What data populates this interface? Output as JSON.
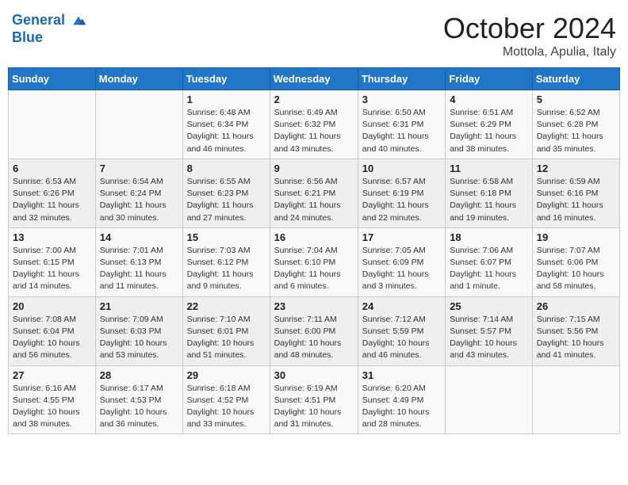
{
  "header": {
    "logo_line1": "General",
    "logo_line2": "Blue",
    "month": "October 2024",
    "location": "Mottola, Apulia, Italy"
  },
  "weekdays": [
    "Sunday",
    "Monday",
    "Tuesday",
    "Wednesday",
    "Thursday",
    "Friday",
    "Saturday"
  ],
  "weeks": [
    [
      {
        "day": "",
        "info": ""
      },
      {
        "day": "",
        "info": ""
      },
      {
        "day": "1",
        "info": "Sunrise: 6:48 AM\nSunset: 6:34 PM\nDaylight: 11 hours and 46 minutes."
      },
      {
        "day": "2",
        "info": "Sunrise: 6:49 AM\nSunset: 6:32 PM\nDaylight: 11 hours and 43 minutes."
      },
      {
        "day": "3",
        "info": "Sunrise: 6:50 AM\nSunset: 6:31 PM\nDaylight: 11 hours and 40 minutes."
      },
      {
        "day": "4",
        "info": "Sunrise: 6:51 AM\nSunset: 6:29 PM\nDaylight: 11 hours and 38 minutes."
      },
      {
        "day": "5",
        "info": "Sunrise: 6:52 AM\nSunset: 6:28 PM\nDaylight: 11 hours and 35 minutes."
      }
    ],
    [
      {
        "day": "6",
        "info": "Sunrise: 6:53 AM\nSunset: 6:26 PM\nDaylight: 11 hours and 32 minutes."
      },
      {
        "day": "7",
        "info": "Sunrise: 6:54 AM\nSunset: 6:24 PM\nDaylight: 11 hours and 30 minutes."
      },
      {
        "day": "8",
        "info": "Sunrise: 6:55 AM\nSunset: 6:23 PM\nDaylight: 11 hours and 27 minutes."
      },
      {
        "day": "9",
        "info": "Sunrise: 6:56 AM\nSunset: 6:21 PM\nDaylight: 11 hours and 24 minutes."
      },
      {
        "day": "10",
        "info": "Sunrise: 6:57 AM\nSunset: 6:19 PM\nDaylight: 11 hours and 22 minutes."
      },
      {
        "day": "11",
        "info": "Sunrise: 6:58 AM\nSunset: 6:18 PM\nDaylight: 11 hours and 19 minutes."
      },
      {
        "day": "12",
        "info": "Sunrise: 6:59 AM\nSunset: 6:16 PM\nDaylight: 11 hours and 16 minutes."
      }
    ],
    [
      {
        "day": "13",
        "info": "Sunrise: 7:00 AM\nSunset: 6:15 PM\nDaylight: 11 hours and 14 minutes."
      },
      {
        "day": "14",
        "info": "Sunrise: 7:01 AM\nSunset: 6:13 PM\nDaylight: 11 hours and 11 minutes."
      },
      {
        "day": "15",
        "info": "Sunrise: 7:03 AM\nSunset: 6:12 PM\nDaylight: 11 hours and 9 minutes."
      },
      {
        "day": "16",
        "info": "Sunrise: 7:04 AM\nSunset: 6:10 PM\nDaylight: 11 hours and 6 minutes."
      },
      {
        "day": "17",
        "info": "Sunrise: 7:05 AM\nSunset: 6:09 PM\nDaylight: 11 hours and 3 minutes."
      },
      {
        "day": "18",
        "info": "Sunrise: 7:06 AM\nSunset: 6:07 PM\nDaylight: 11 hours and 1 minute."
      },
      {
        "day": "19",
        "info": "Sunrise: 7:07 AM\nSunset: 6:06 PM\nDaylight: 10 hours and 58 minutes."
      }
    ],
    [
      {
        "day": "20",
        "info": "Sunrise: 7:08 AM\nSunset: 6:04 PM\nDaylight: 10 hours and 56 minutes."
      },
      {
        "day": "21",
        "info": "Sunrise: 7:09 AM\nSunset: 6:03 PM\nDaylight: 10 hours and 53 minutes."
      },
      {
        "day": "22",
        "info": "Sunrise: 7:10 AM\nSunset: 6:01 PM\nDaylight: 10 hours and 51 minutes."
      },
      {
        "day": "23",
        "info": "Sunrise: 7:11 AM\nSunset: 6:00 PM\nDaylight: 10 hours and 48 minutes."
      },
      {
        "day": "24",
        "info": "Sunrise: 7:12 AM\nSunset: 5:59 PM\nDaylight: 10 hours and 46 minutes."
      },
      {
        "day": "25",
        "info": "Sunrise: 7:14 AM\nSunset: 5:57 PM\nDaylight: 10 hours and 43 minutes."
      },
      {
        "day": "26",
        "info": "Sunrise: 7:15 AM\nSunset: 5:56 PM\nDaylight: 10 hours and 41 minutes."
      }
    ],
    [
      {
        "day": "27",
        "info": "Sunrise: 6:16 AM\nSunset: 4:55 PM\nDaylight: 10 hours and 38 minutes."
      },
      {
        "day": "28",
        "info": "Sunrise: 6:17 AM\nSunset: 4:53 PM\nDaylight: 10 hours and 36 minutes."
      },
      {
        "day": "29",
        "info": "Sunrise: 6:18 AM\nSunset: 4:52 PM\nDaylight: 10 hours and 33 minutes."
      },
      {
        "day": "30",
        "info": "Sunrise: 6:19 AM\nSunset: 4:51 PM\nDaylight: 10 hours and 31 minutes."
      },
      {
        "day": "31",
        "info": "Sunrise: 6:20 AM\nSunset: 4:49 PM\nDaylight: 10 hours and 28 minutes."
      },
      {
        "day": "",
        "info": ""
      },
      {
        "day": "",
        "info": ""
      }
    ]
  ]
}
